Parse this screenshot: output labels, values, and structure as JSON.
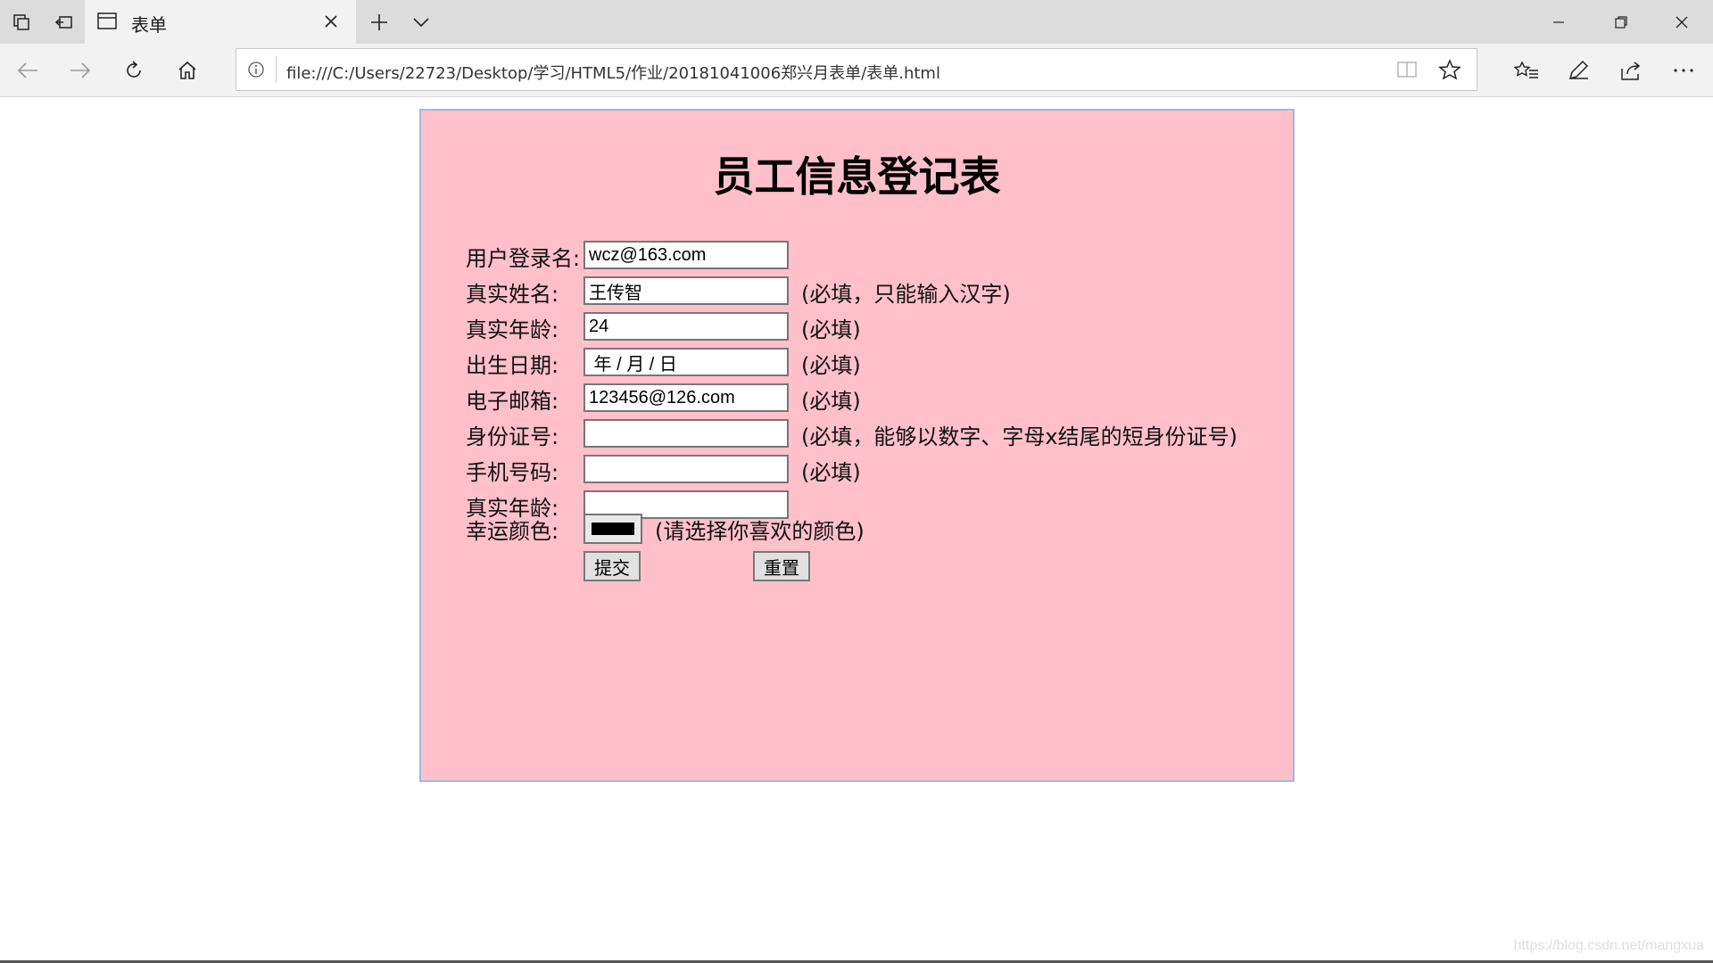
{
  "browser": {
    "tab_title": "表单",
    "address": "file:///C:/Users/22723/Desktop/学习/HTML5/作业/20181041006郑兴月表单/表单.html"
  },
  "form": {
    "title": "员工信息登记表",
    "rows": [
      {
        "label": "用户登录名:",
        "value": "wcz@163.com",
        "hint": ""
      },
      {
        "label": "真实姓名:",
        "value": "王传智",
        "hint": "(必填，只能输入汉字)"
      },
      {
        "label": "真实年龄:",
        "value": "24",
        "hint": "(必填)"
      },
      {
        "label": "出生日期:",
        "value": " 年 / 月 / 日",
        "hint": "(必填)"
      },
      {
        "label": "电子邮箱:",
        "value": "123456@126.com",
        "hint": "(必填)"
      },
      {
        "label": "身份证号:",
        "value": "",
        "hint": "(必填，能够以数字、字母x结尾的短身份证号)"
      },
      {
        "label": "手机号码:",
        "value": "",
        "hint": "(必填)"
      },
      {
        "label": "真实年龄:",
        "value": "",
        "hint": ""
      }
    ],
    "color": {
      "label": "幸运颜色:",
      "value": "#000000",
      "hint": "(请选择你喜欢的颜色)"
    },
    "submit_label": "提交",
    "reset_label": "重置"
  },
  "watermark": "https://blog.csdn.net/mangxua",
  "colors": {
    "form_background": "#ffc0cb",
    "form_border": "#9bbbe3"
  }
}
